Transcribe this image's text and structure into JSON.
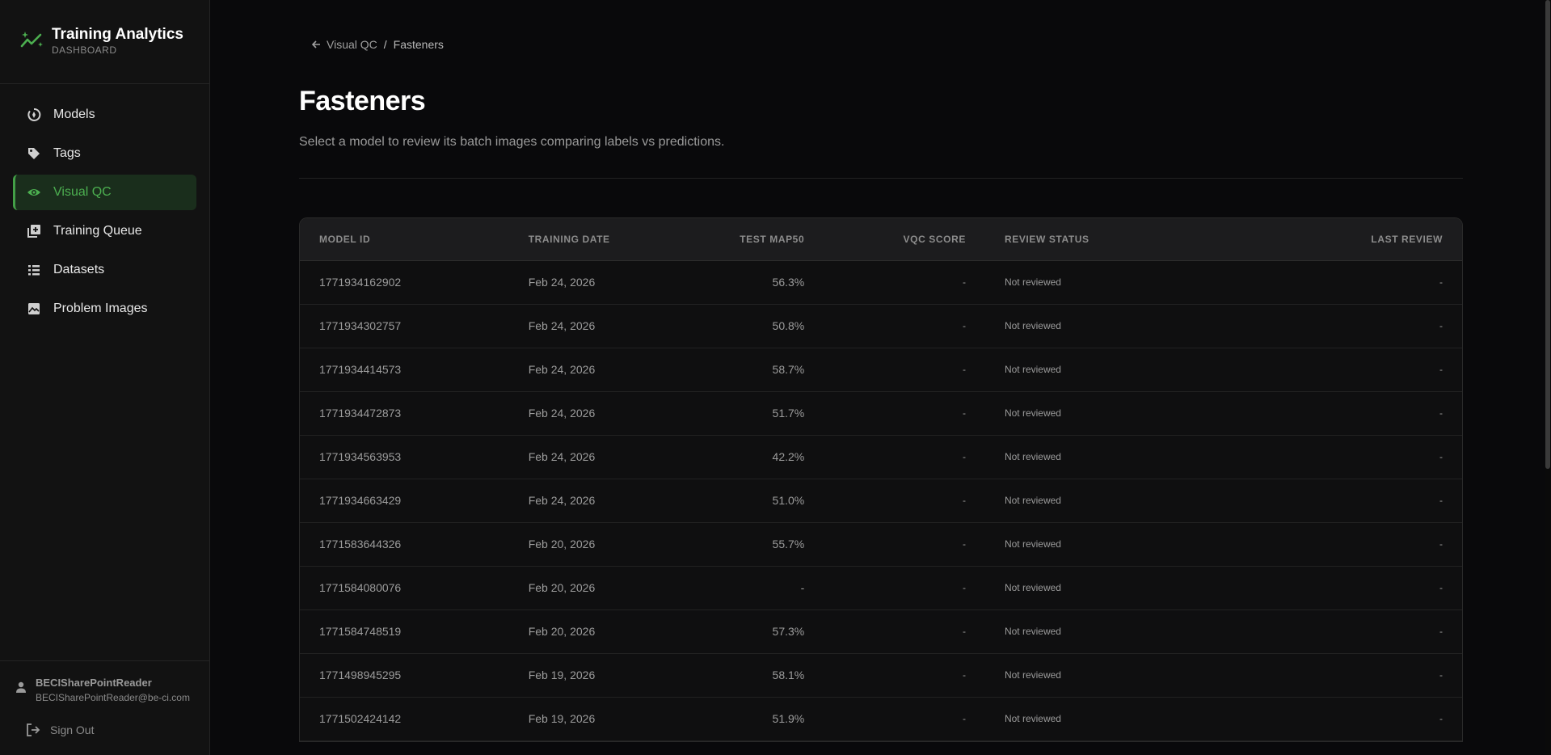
{
  "brand": {
    "title": "Training Analytics",
    "subtitle": "DASHBOARD",
    "accent": "#4caf50"
  },
  "nav": [
    {
      "label": "Models",
      "icon": "models-icon",
      "active": false
    },
    {
      "label": "Tags",
      "icon": "tag-icon",
      "active": false
    },
    {
      "label": "Visual QC",
      "icon": "eye-icon",
      "active": true
    },
    {
      "label": "Training Queue",
      "icon": "queue-add-icon",
      "active": false
    },
    {
      "label": "Datasets",
      "icon": "list-icon",
      "active": false
    },
    {
      "label": "Problem Images",
      "icon": "image-icon",
      "active": false
    }
  ],
  "user": {
    "name": "BECISharePointReader",
    "email": "BECISharePointReader@be-ci.com",
    "sign_out": "Sign Out"
  },
  "breadcrumb": {
    "parent": "Visual QC",
    "separator": "/",
    "current": "Fasteners"
  },
  "page": {
    "title": "Fasteners",
    "subtitle": "Select a model to review its batch images comparing labels vs predictions."
  },
  "table": {
    "columns": [
      "MODEL ID",
      "TRAINING DATE",
      "TEST MAP50",
      "VQC SCORE",
      "REVIEW STATUS",
      "LAST REVIEW"
    ],
    "rows": [
      [
        "1771934162902",
        "Feb 24, 2026",
        "56.3%",
        "-",
        "Not reviewed",
        "-"
      ],
      [
        "1771934302757",
        "Feb 24, 2026",
        "50.8%",
        "-",
        "Not reviewed",
        "-"
      ],
      [
        "1771934414573",
        "Feb 24, 2026",
        "58.7%",
        "-",
        "Not reviewed",
        "-"
      ],
      [
        "1771934472873",
        "Feb 24, 2026",
        "51.7%",
        "-",
        "Not reviewed",
        "-"
      ],
      [
        "1771934563953",
        "Feb 24, 2026",
        "42.2%",
        "-",
        "Not reviewed",
        "-"
      ],
      [
        "1771934663429",
        "Feb 24, 2026",
        "51.0%",
        "-",
        "Not reviewed",
        "-"
      ],
      [
        "1771583644326",
        "Feb 20, 2026",
        "55.7%",
        "-",
        "Not reviewed",
        "-"
      ],
      [
        "1771584080076",
        "Feb 20, 2026",
        "-",
        "-",
        "Not reviewed",
        "-"
      ],
      [
        "1771584748519",
        "Feb 20, 2026",
        "57.3%",
        "-",
        "Not reviewed",
        "-"
      ],
      [
        "1771498945295",
        "Feb 19, 2026",
        "58.1%",
        "-",
        "Not reviewed",
        "-"
      ],
      [
        "1771502424142",
        "Feb 19, 2026",
        "51.9%",
        "-",
        "Not reviewed",
        "-"
      ]
    ]
  }
}
